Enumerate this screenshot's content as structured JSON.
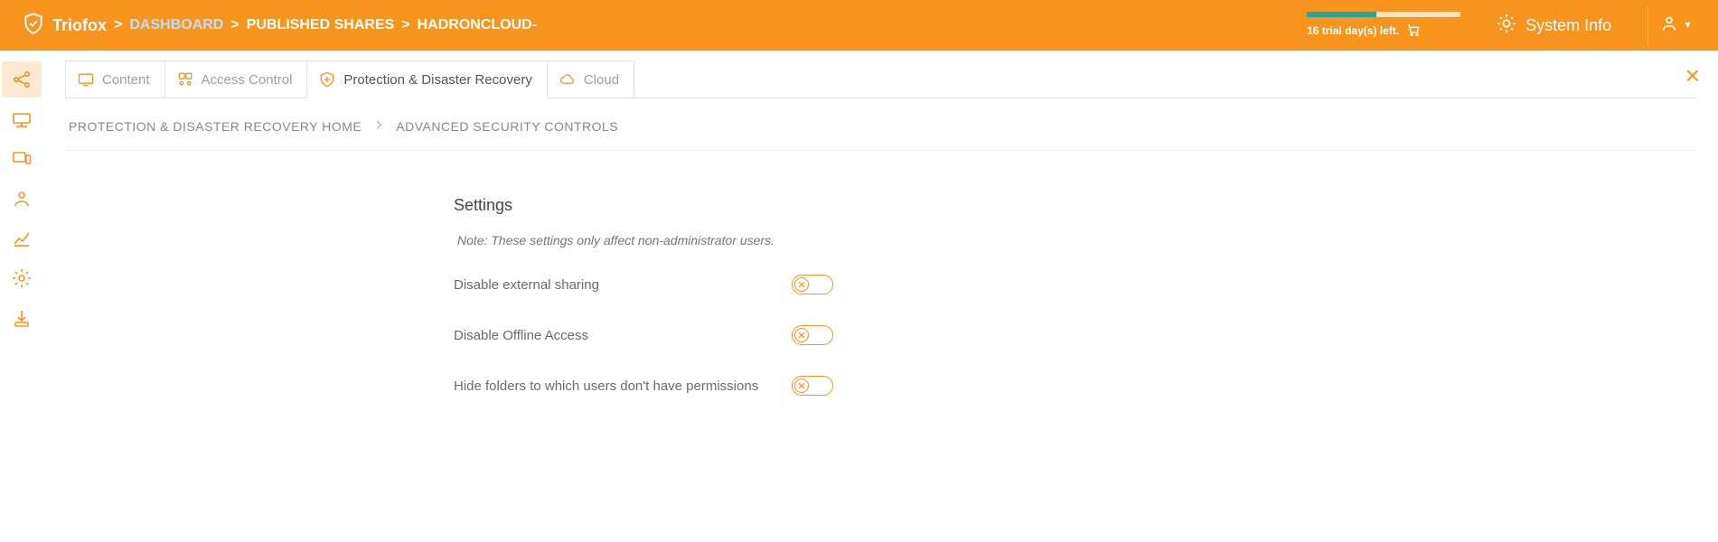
{
  "header": {
    "brand": "Triofox",
    "breadcrumbs": [
      "DASHBOARD",
      "PUBLISHED SHARES",
      "HADRONCLOUD-"
    ],
    "active_index": 0,
    "trial_text": "16 trial day(s) left.",
    "trial_progress_pct": 45,
    "system_info": "System Info"
  },
  "tabs": [
    {
      "label": "Content"
    },
    {
      "label": "Access Control"
    },
    {
      "label": "Protection & Disaster Recovery"
    },
    {
      "label": "Cloud"
    }
  ],
  "tabs_active_index": 2,
  "inner_breadcrumb": [
    "PROTECTION & DISASTER RECOVERY HOME",
    "ADVANCED SECURITY CONTROLS"
  ],
  "settings": {
    "title": "Settings",
    "note": "Note: These settings only affect non-administrator users.",
    "rows": [
      {
        "label": "Disable external sharing",
        "value": false
      },
      {
        "label": "Disable Offline Access",
        "value": false
      },
      {
        "label": "Hide folders to which users don't have permissions",
        "value": false
      }
    ]
  }
}
